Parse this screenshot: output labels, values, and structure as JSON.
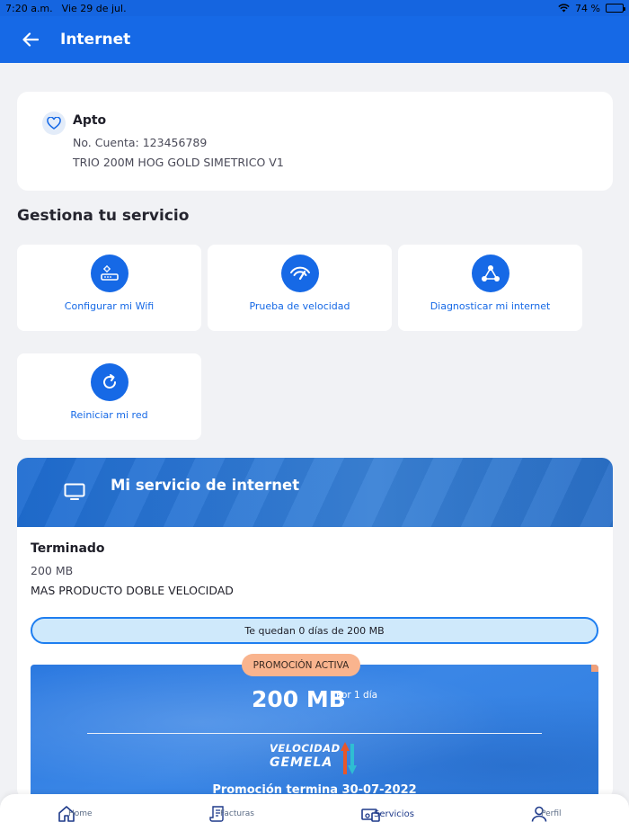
{
  "status_bar": {
    "time": "7:20 a.m.",
    "date": "Vie 29 de jul.",
    "battery": "74 %",
    "battery_level": 0.74
  },
  "header": {
    "title": "Internet",
    "back_icon": "arrow-left-icon"
  },
  "account": {
    "name": "Apto",
    "account_number": "No. Cuenta:  123456789",
    "plan": "TRIO 200M HOG GOLD SIMETRICO V1",
    "icon": "heart-icon"
  },
  "manage": {
    "title": "Gestiona tu servicio",
    "tiles": [
      {
        "label": "Configurar mi Wifi",
        "icon": "router-icon"
      },
      {
        "label": "Prueba de velocidad",
        "icon": "speedometer-icon"
      },
      {
        "label": "Diagnosticar mi internet",
        "icon": "network-icon"
      },
      {
        "label": "Reiniciar mi red",
        "icon": "refresh-icon"
      }
    ]
  },
  "service": {
    "title": "Mi servicio de internet",
    "icon": "tv-icon",
    "status": "Terminado",
    "size": "200 MB",
    "product": "MAS PRODUCTO DOBLE VELOCIDAD",
    "remaining": "Te quedan 0 días de 200 MB"
  },
  "promo": {
    "badge": "PROMOCIÓN ACTIVA",
    "amount": "200 MB",
    "period": "Por 1 día",
    "logo_line1": "VELOCIDAD",
    "logo_line2": "GEMELA",
    "ends": "Promoción termina 30-07-2022"
  },
  "nav": {
    "items": [
      {
        "label": "Home",
        "icon": "home-icon"
      },
      {
        "label": "Facturas",
        "icon": "invoice-icon"
      },
      {
        "label": "Servicios",
        "icon": "devices-icon",
        "active": true
      },
      {
        "label": "Perfil",
        "icon": "user-icon"
      }
    ]
  },
  "colors": {
    "primary": "#1669e6",
    "background": "#f1f2f5",
    "badge": "#f9b48e",
    "pill": "#cfe9fb"
  }
}
